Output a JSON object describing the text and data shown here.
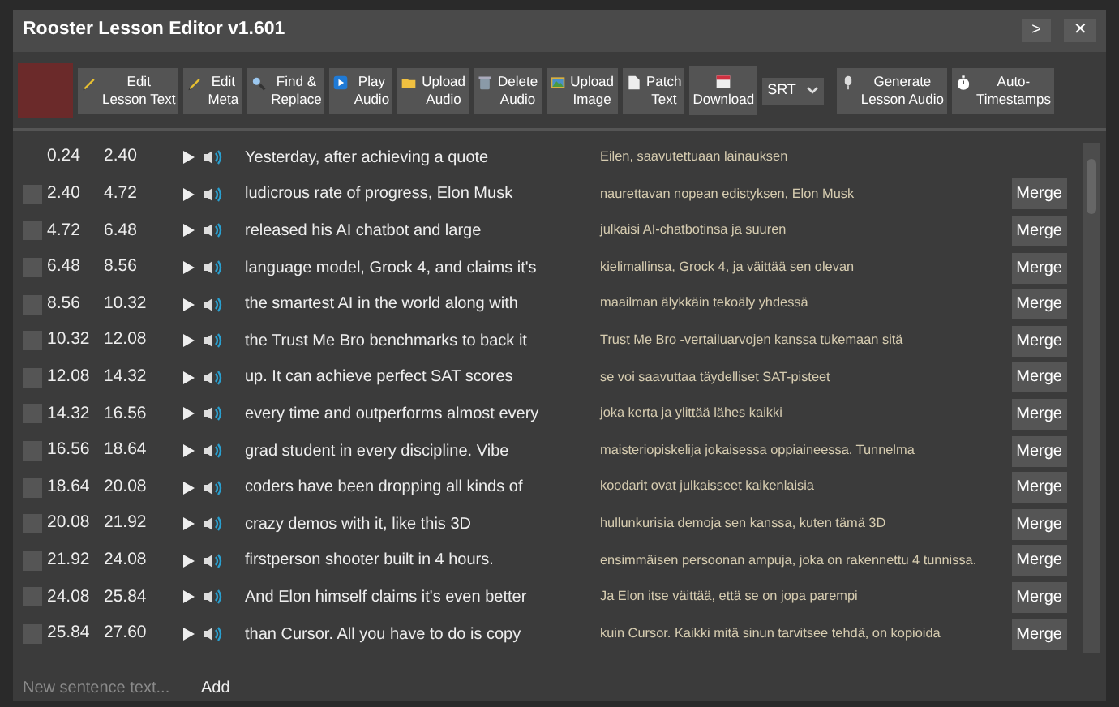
{
  "window": {
    "title": "Rooster Lesson Editor v1.601",
    "controls": [
      ">",
      "✕"
    ]
  },
  "toolbar": {
    "buttons": [
      {
        "lines": [
          "Edit",
          "Lesson Text"
        ]
      },
      {
        "lines": [
          "Edit",
          "Meta"
        ]
      },
      {
        "lines": [
          "Find &",
          "Replace"
        ]
      },
      {
        "lines": [
          "Play",
          "Audio"
        ]
      },
      {
        "lines": [
          "Upload",
          "Audio"
        ]
      },
      {
        "lines": [
          "Delete",
          "Audio"
        ]
      },
      {
        "lines": [
          "Upload",
          "Image"
        ]
      },
      {
        "lines": [
          "Patch",
          "Text"
        ]
      },
      {
        "lines": [
          "Download"
        ]
      }
    ],
    "format_select": "SRT",
    "right_buttons": [
      {
        "lines": [
          "Generate",
          "Lesson Audio"
        ]
      },
      {
        "lines": [
          "Auto-",
          "Timestamps"
        ]
      }
    ]
  },
  "rows": [
    {
      "start": "0.24",
      "end": "2.40",
      "text": "Yesterday, after achieving a quote",
      "translation": "Eilen, saavutettuaan lainauksen"
    },
    {
      "start": "2.40",
      "end": "4.72",
      "text": "ludicrous rate of progress, Elon Musk",
      "translation": "naurettavan nopean edistyksen, Elon Musk",
      "merge": "Merge"
    },
    {
      "start": "4.72",
      "end": "6.48",
      "text": "released his AI chatbot and large",
      "translation": "julkaisi AI-chatbotinsa ja suuren",
      "merge": "Merge"
    },
    {
      "start": "6.48",
      "end": "8.56",
      "text": "language model, Grock 4, and claims it's",
      "translation": "kielimallinsa, Grock 4, ja väittää sen olevan",
      "merge": "Merge"
    },
    {
      "start": "8.56",
      "end": "10.32",
      "text": "the smartest AI in the world along with",
      "translation": "maailman älykkäin tekoäly yhdessä",
      "merge": "Merge"
    },
    {
      "start": "10.32",
      "end": "12.08",
      "text": "the Trust Me Bro benchmarks to back it",
      "translation": "Trust Me Bro -vertailuarvojen kanssa tukemaan sitä",
      "merge": "Merge"
    },
    {
      "start": "12.08",
      "end": "14.32",
      "text": "up. It can achieve perfect SAT scores",
      "translation": "se voi saavuttaa täydelliset SAT-pisteet",
      "merge": "Merge"
    },
    {
      "start": "14.32",
      "end": "16.56",
      "text": "every time and outperforms almost every",
      "translation": "joka kerta ja ylittää lähes kaikki",
      "merge": "Merge"
    },
    {
      "start": "16.56",
      "end": "18.64",
      "text": "grad student in every discipline. Vibe",
      "translation": "maisteriopiskelija jokaisessa oppiaineessa. Tunnelma",
      "merge": "Merge"
    },
    {
      "start": "18.64",
      "end": "20.08",
      "text": "coders have been dropping all kinds of",
      "translation": "koodarit ovat julkaisseet kaikenlaisia",
      "merge": "Merge"
    },
    {
      "start": "20.08",
      "end": "21.92",
      "text": "crazy demos with it, like this 3D",
      "translation": "hullunkurisia demoja sen kanssa, kuten tämä 3D",
      "merge": "Merge"
    },
    {
      "start": "21.92",
      "end": "24.08",
      "text": "firstperson shooter built in 4 hours.",
      "translation": "ensimmäisen persoonan ampuja, joka on rakennettu 4 tunnissa.",
      "merge": "Merge"
    },
    {
      "start": "24.08",
      "end": "25.84",
      "text": "And Elon himself claims it's even better",
      "translation": "Ja Elon itse väittää, että se on jopa parempi",
      "merge": "Merge"
    },
    {
      "start": "25.84",
      "end": "27.60",
      "text": "than Cursor. All you have to do is copy",
      "translation": "kuin Cursor. Kaikki mitä sinun tarvitsee tehdä, on kopioida",
      "merge": "Merge"
    }
  ],
  "new_sentence": {
    "placeholder": "New sentence text...",
    "button": "Add"
  }
}
